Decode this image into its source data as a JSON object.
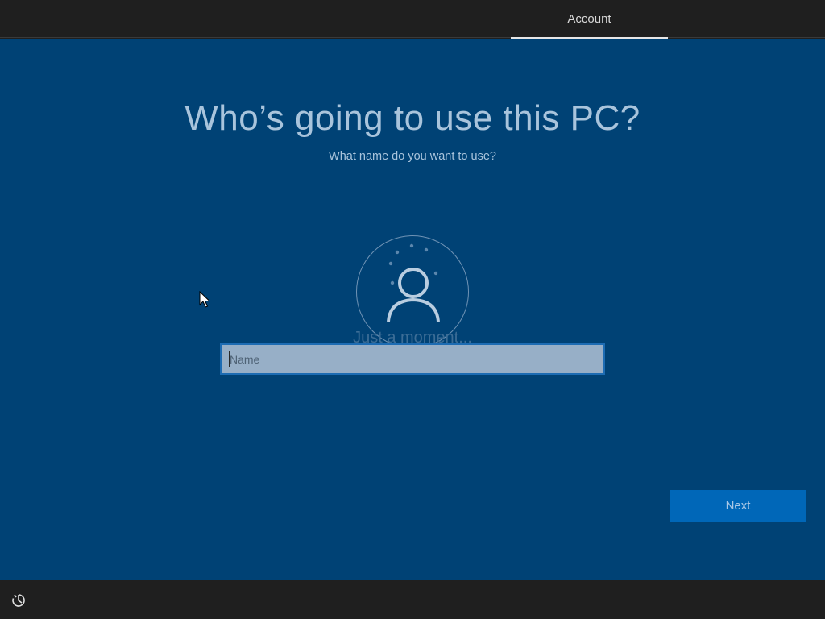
{
  "header": {
    "tabs": [
      {
        "label": "Account",
        "active": true
      }
    ]
  },
  "main": {
    "title": "Who’s going to use this PC?",
    "subtitle": "What name do you want to use?",
    "avatar_icon": "user-avatar-icon",
    "loading_text": "Just a moment...",
    "name_input": {
      "value": "",
      "placeholder": "Name"
    },
    "next_label": "Next"
  },
  "footer": {
    "ease_of_access_icon": "ease-of-access-icon"
  },
  "colors": {
    "background": "#004275",
    "bar": "#1f1f1f",
    "accent": "#0067b8",
    "text": "#a9c4dc"
  }
}
